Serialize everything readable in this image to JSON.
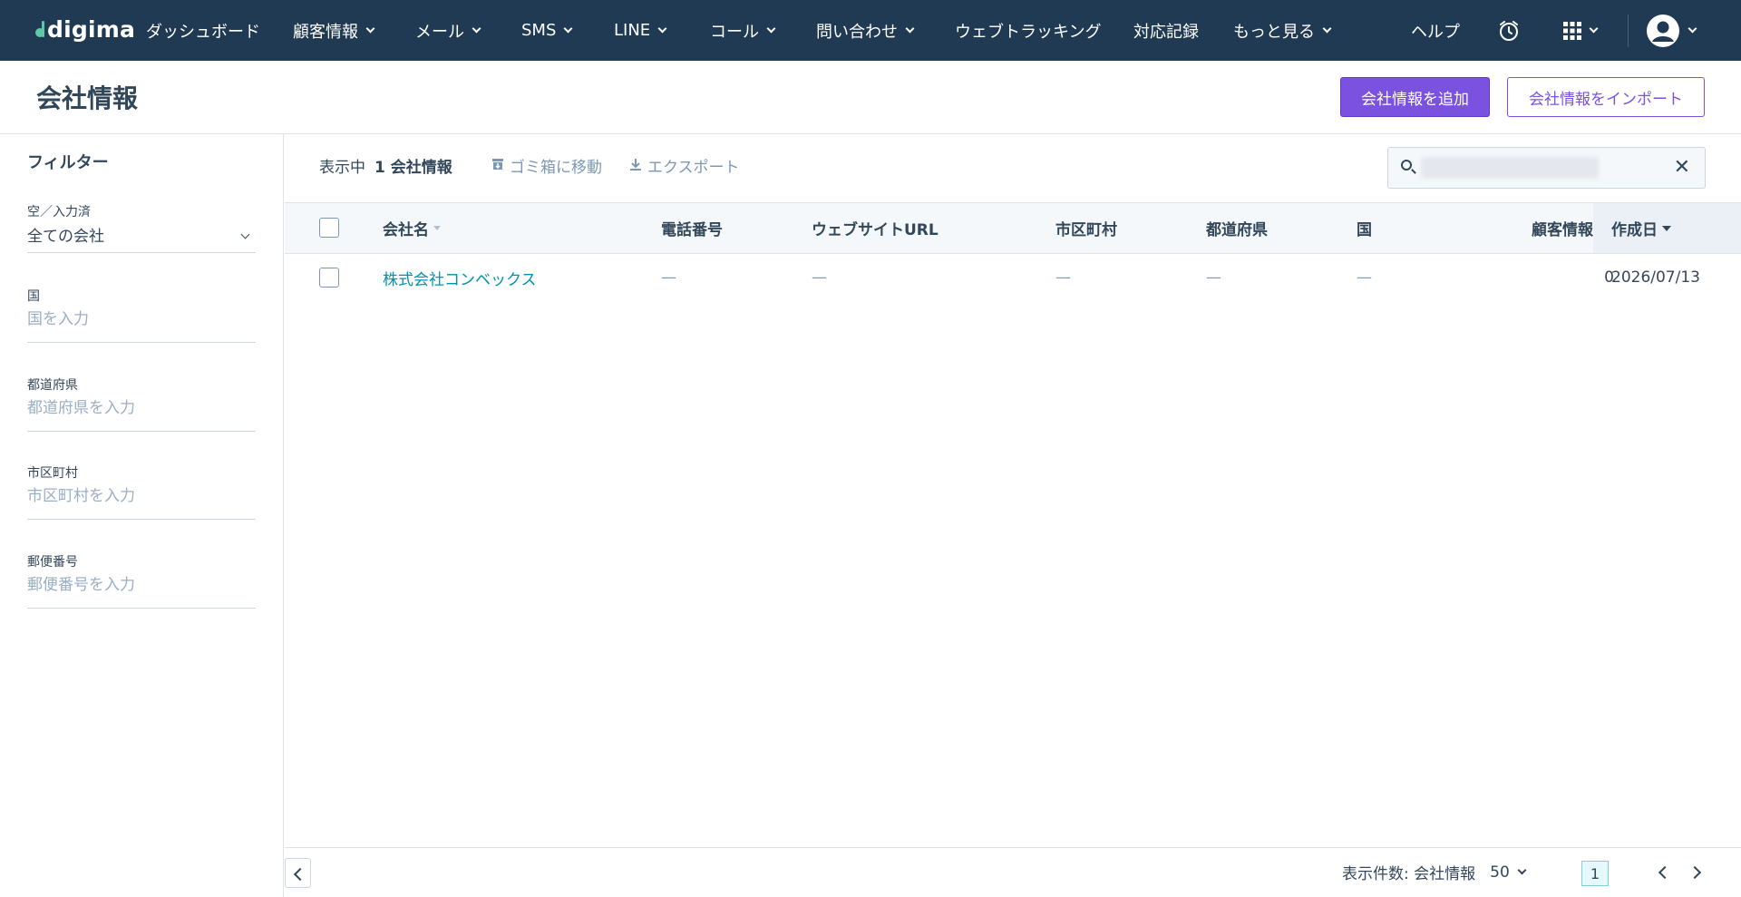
{
  "nav": {
    "logo": "digima",
    "items": [
      {
        "label": "ダッシュボード",
        "dropdown": false
      },
      {
        "label": "顧客情報",
        "dropdown": true
      },
      {
        "label": "メール",
        "dropdown": true
      },
      {
        "label": "SMS",
        "dropdown": true
      },
      {
        "label": "LINE",
        "dropdown": true
      },
      {
        "label": "コール",
        "dropdown": true
      },
      {
        "label": "問い合わせ",
        "dropdown": true
      },
      {
        "label": "ウェブトラッキング",
        "dropdown": false
      },
      {
        "label": "対応記録",
        "dropdown": false
      },
      {
        "label": "もっと見る",
        "dropdown": true
      }
    ],
    "help": "ヘルプ",
    "icons": [
      "alarm-clock-icon",
      "apps-grid-icon",
      "user-avatar-icon"
    ]
  },
  "header": {
    "title": "会社情報",
    "add_button": "会社情報を追加",
    "import_button": "会社情報をインポート"
  },
  "sidebar": {
    "title": "フィルター",
    "filters": [
      {
        "label": "空／入力済",
        "value": "全ての会社",
        "type": "select"
      },
      {
        "label": "国",
        "placeholder": "国を入力",
        "type": "input"
      },
      {
        "label": "都道府県",
        "placeholder": "都道府県を入力",
        "type": "input"
      },
      {
        "label": "市区町村",
        "placeholder": "市区町村を入力",
        "type": "input"
      },
      {
        "label": "郵便番号",
        "placeholder": "郵便番号を入力",
        "type": "input"
      }
    ]
  },
  "toolbar": {
    "showing": "表示中",
    "count_label": "1 会社情報",
    "trash": "ゴミ箱に移動",
    "export": "エクスポート",
    "search_value": ""
  },
  "table": {
    "columns": [
      "会社名",
      "電話番号",
      "ウェブサイトURL",
      "市区町村",
      "都道府県",
      "国",
      "顧客情報数",
      "作成日"
    ],
    "sorted_column": "作成日",
    "rows": [
      {
        "name": "株式会社コンベックス",
        "phone": "—",
        "website": "—",
        "city": "—",
        "prefecture": "—",
        "country": "—",
        "contacts": "0",
        "created": "2026/07/13"
      }
    ]
  },
  "footer": {
    "per_page_label": "表示件数: 会社情報",
    "per_page_value": "50",
    "current_page": "1"
  },
  "colors": {
    "nav_bg": "#1f3a52",
    "primary": "#7b52e0",
    "link": "#0091ae",
    "logo_accent": "#5ec8a8"
  }
}
